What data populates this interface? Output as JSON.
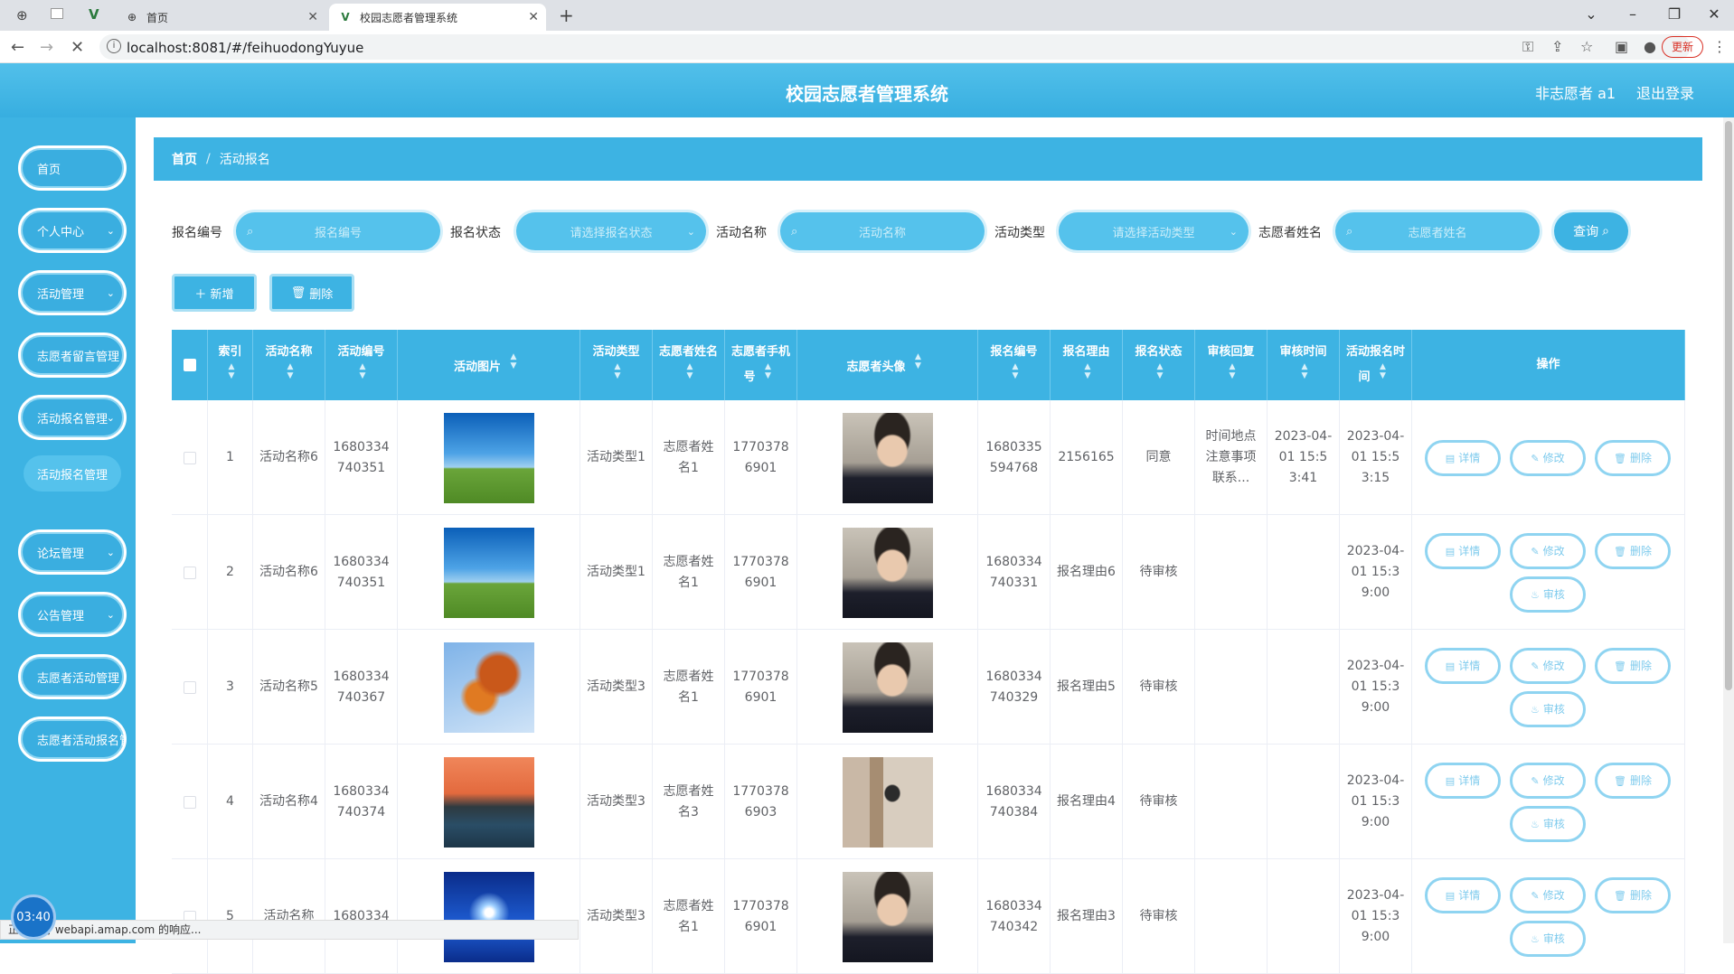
{
  "browser": {
    "tabs": [
      {
        "label": "首页",
        "active": false
      },
      {
        "label": "校园志愿者管理系统",
        "active": true
      }
    ],
    "new_tab": "+",
    "url": "localhost:8081/#/feihuodongYuyue",
    "update_label": "更新",
    "status_text": "正在等待 webapi.amap.com 的响应...",
    "clock": "03:40"
  },
  "header": {
    "title": "校园志愿者管理系统",
    "user": "非志愿者 a1",
    "logout": "退出登录"
  },
  "sidebar": {
    "items": [
      {
        "label": "首页",
        "has_arrow": false
      },
      {
        "label": "个人中心",
        "has_arrow": true
      },
      {
        "label": "活动管理",
        "has_arrow": true
      },
      {
        "label": "志愿者留言管理",
        "has_arrow": false
      },
      {
        "label": "活动报名管理",
        "has_arrow": true
      },
      {
        "label": "论坛管理",
        "has_arrow": true
      },
      {
        "label": "公告管理",
        "has_arrow": true
      },
      {
        "label": "志愿者活动管理",
        "has_arrow": false
      },
      {
        "label": "志愿者活动报名管",
        "has_arrow": false
      }
    ],
    "sub_item": "活动报名管理"
  },
  "breadcrumb": {
    "home": "首页",
    "separator": "/",
    "current": "活动报名"
  },
  "search": {
    "fields": [
      {
        "label": "报名编号",
        "placeholder": "报名编号",
        "type": "input"
      },
      {
        "label": "报名状态",
        "placeholder": "请选择报名状态",
        "type": "select"
      },
      {
        "label": "活动名称",
        "placeholder": "活动名称",
        "type": "input"
      },
      {
        "label": "活动类型",
        "placeholder": "请选择活动类型",
        "type": "select"
      },
      {
        "label": "志愿者姓名",
        "placeholder": "志愿者姓名",
        "type": "input"
      }
    ],
    "query_label": "查询"
  },
  "actions": {
    "add_label": "＋ 新增",
    "delete_label": "删除"
  },
  "table": {
    "columns": [
      "索引",
      "活动名称",
      "活动编号",
      "活动图片",
      "活动类型",
      "志愿者姓名",
      "志愿者手机号",
      "志愿者头像",
      "报名编号",
      "报名理由",
      "报名状态",
      "审核回复",
      "审核时间",
      "活动报名时间",
      "操作"
    ],
    "buttons": {
      "detail": "详情",
      "edit": "修改",
      "delete": "删除",
      "review": "审核"
    },
    "rows": [
      {
        "index": "1",
        "name": "活动名称6",
        "code": "1680334740351",
        "image": "sky-meadow",
        "type": "活动类型1",
        "volunteer": "志愿者姓名1",
        "phone": "17703786901",
        "avatar": "man-portrait",
        "reg_no": "1680335594768",
        "reason": "2156165",
        "status": "同意",
        "reply": "时间地点注意事项联系...",
        "review_time": "2023-04-01 15:53:41",
        "reg_time": "2023-04-01 15:53:15",
        "reviewable": false
      },
      {
        "index": "2",
        "name": "活动名称6",
        "code": "1680334740351",
        "image": "sky-meadow",
        "type": "活动类型1",
        "volunteer": "志愿者姓名1",
        "phone": "17703786901",
        "avatar": "man-portrait",
        "reg_no": "1680334740331",
        "reason": "报名理由6",
        "status": "待审核",
        "reply": "",
        "review_time": "",
        "reg_time": "2023-04-01 15:39:00",
        "reviewable": true
      },
      {
        "index": "3",
        "name": "活动名称5",
        "code": "1680334740367",
        "image": "autumn-leaves",
        "type": "活动类型3",
        "volunteer": "志愿者姓名1",
        "phone": "17703786901",
        "avatar": "man-portrait",
        "reg_no": "1680334740329",
        "reason": "报名理由5",
        "status": "待审核",
        "reply": "",
        "review_time": "",
        "reg_time": "2023-04-01 15:39:00",
        "reviewable": true
      },
      {
        "index": "4",
        "name": "活动名称4",
        "code": "1680334740374",
        "image": "sunset-lake",
        "type": "活动类型3",
        "volunteer": "志愿者姓名3",
        "phone": "17703786903",
        "avatar": "person-gallery",
        "reg_no": "1680334740384",
        "reason": "报名理由4",
        "status": "待审核",
        "reply": "",
        "review_time": "",
        "reg_time": "2023-04-01 15:39:00",
        "reviewable": true
      },
      {
        "index": "5",
        "name": "活动名称",
        "code": "1680334",
        "image": "blue-sun",
        "type": "活动类型3",
        "volunteer": "志愿者姓名1",
        "phone": "17703786901",
        "avatar": "man-portrait",
        "reg_no": "1680334740342",
        "reason": "报名理由3",
        "status": "待审核",
        "reply": "",
        "review_time": "",
        "reg_time": "2023-04-01 15:39:00",
        "reviewable": true
      }
    ]
  },
  "colors": {
    "primary": "#3db3e3",
    "header": "#45b8e6",
    "button_outline": "#8fd4f1"
  }
}
